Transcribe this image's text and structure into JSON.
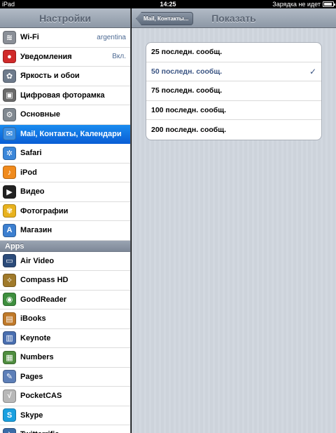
{
  "status_bar": {
    "carrier": "iPad",
    "time": "14:25",
    "charging": "Зарядка не идет"
  },
  "left": {
    "title": "Настройки",
    "items": [
      {
        "label": "Wi-Fi",
        "value": "argentina",
        "icon": "wifi-icon",
        "color": "#8a8f97",
        "glyph": "≋"
      },
      {
        "label": "Уведомления",
        "value": "Вкл.",
        "icon": "notifications-icon",
        "color": "#d02a2a",
        "glyph": "●"
      },
      {
        "label": "Яркость и обои",
        "value": "",
        "icon": "brightness-icon",
        "color": "#6e7b8c",
        "glyph": "✿"
      },
      {
        "label": "Цифровая фоторамка",
        "value": "",
        "icon": "photo-frame-icon",
        "color": "#6b6b6b",
        "glyph": "▣"
      },
      {
        "label": "Основные",
        "value": "",
        "icon": "gear-icon",
        "color": "#808890",
        "glyph": "⚙"
      },
      {
        "label": "Mail, Контакты, Календари",
        "value": "",
        "icon": "mail-icon",
        "color": "#3d8ee0",
        "glyph": "✉"
      },
      {
        "label": "Safari",
        "value": "",
        "icon": "safari-icon",
        "color": "#3a86d9",
        "glyph": "✲"
      },
      {
        "label": "iPod",
        "value": "",
        "icon": "ipod-icon",
        "color": "#f08a1c",
        "glyph": "♪"
      },
      {
        "label": "Видео",
        "value": "",
        "icon": "video-icon",
        "color": "#222222",
        "glyph": "▶"
      },
      {
        "label": "Фотографии",
        "value": "",
        "icon": "photos-icon",
        "color": "#e8b21e",
        "glyph": "✾"
      },
      {
        "label": "Магазин",
        "value": "",
        "icon": "store-icon",
        "color": "#3c7fd0",
        "glyph": "A"
      }
    ],
    "apps_header": "Apps",
    "apps": [
      {
        "label": "Air Video",
        "icon": "air-video-icon",
        "color": "#2c4b7a",
        "glyph": "▭"
      },
      {
        "label": "Compass HD",
        "icon": "compass-icon",
        "color": "#a07a2a",
        "glyph": "✧"
      },
      {
        "label": "GoodReader",
        "icon": "goodreader-icon",
        "color": "#3e8f3e",
        "glyph": "◉"
      },
      {
        "label": "iBooks",
        "icon": "ibooks-icon",
        "color": "#c07a2a",
        "glyph": "▤"
      },
      {
        "label": "Keynote",
        "icon": "keynote-icon",
        "color": "#4a6fb0",
        "glyph": "▥"
      },
      {
        "label": "Numbers",
        "icon": "numbers-icon",
        "color": "#4f8d3f",
        "glyph": "▦"
      },
      {
        "label": "Pages",
        "icon": "pages-icon",
        "color": "#5d7fb8",
        "glyph": "✎"
      },
      {
        "label": "PocketCAS",
        "icon": "pocketcas-icon",
        "color": "#b8b8b8",
        "glyph": "√"
      },
      {
        "label": "Skype",
        "icon": "skype-icon",
        "color": "#1aa0e0",
        "glyph": "S"
      },
      {
        "label": "Twitterrific",
        "icon": "twitterrific-icon",
        "color": "#3b6ca8",
        "glyph": "✈"
      }
    ],
    "selected_index": 5
  },
  "right": {
    "back_label": "Mail, Контакты...",
    "title": "Показать",
    "options": [
      {
        "label": "25 последн. сообщ.",
        "checked": false
      },
      {
        "label": "50 последн. сообщ.",
        "checked": true
      },
      {
        "label": "75 последн. сообщ.",
        "checked": false
      },
      {
        "label": "100 последн. сообщ.",
        "checked": false
      },
      {
        "label": "200 последн. сообщ.",
        "checked": false
      }
    ],
    "check_glyph": "✓"
  }
}
